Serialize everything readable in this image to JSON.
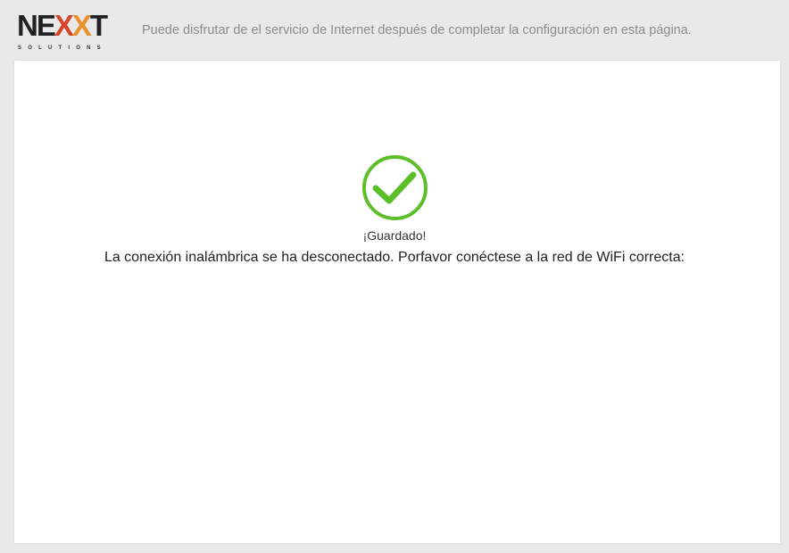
{
  "header": {
    "logo": {
      "word_prefix": "NE",
      "word_x1": "X",
      "word_x2": "X",
      "word_suffix": "T",
      "subtitle": "SOLUTIONS"
    },
    "tagline": "Puede disfrutar de el servicio de Internet después de completar la configuración en esta página."
  },
  "result": {
    "icon": "checkmark-circle-icon",
    "status_text": "¡Guardado!",
    "message": "La conexión inalámbrica se ha desconectado. Porfavor conéctese a la red de WiFi correcta:",
    "ssid": ""
  },
  "colors": {
    "check_green": "#5cbf2a",
    "background": "#e9e9e9",
    "panel": "#ffffff",
    "tagline": "#8c8c8c"
  }
}
